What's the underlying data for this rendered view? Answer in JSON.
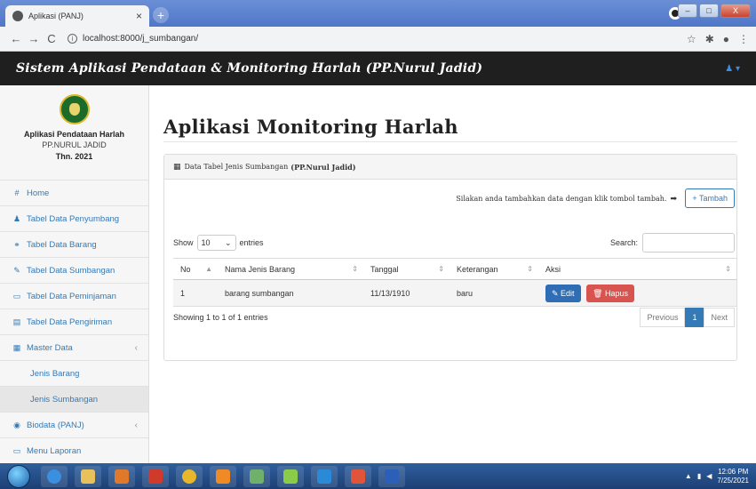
{
  "browser": {
    "tab_title": "Aplikasi (PANJ)",
    "tab_close": "×",
    "new_tab": "+",
    "url": "localhost:8000/j_sumbangan/",
    "win_min": "–",
    "win_max": "□",
    "win_close": "X"
  },
  "app": {
    "title": "Sistem Aplikasi Pendataan & Monitoring Harlah (PP.Nurul Jadid)",
    "user_icon": "user-icon"
  },
  "sidebar": {
    "brand_name": "Aplikasi Pendataan Harlah",
    "brand_org": "PP.NURUL JADID",
    "brand_year": "Thn. 2021",
    "items": [
      {
        "label": "Home",
        "icon": "#"
      },
      {
        "label": "Tabel Data Penyumbang",
        "icon": "♟"
      },
      {
        "label": "Tabel Data Barang",
        "icon": "⚭"
      },
      {
        "label": "Tabel Data Sumbangan",
        "icon": "✎"
      },
      {
        "label": "Tabel Data Peminjaman",
        "icon": "▭"
      },
      {
        "label": "Tabel Data Pengiriman",
        "icon": "▤"
      },
      {
        "label": "Master Data",
        "icon": "▦"
      },
      {
        "label": "Jenis Barang"
      },
      {
        "label": "Jenis Sumbangan"
      },
      {
        "label": "Biodata (PANJ)",
        "icon": "◉"
      },
      {
        "label": "Menu Laporan",
        "icon": "▭"
      }
    ]
  },
  "main": {
    "page_title": "Aplikasi Monitoring Harlah",
    "panel_title": "Data Tabel Jenis Sumbangan",
    "panel_title_bold": "(PP.Nurul Jadid)",
    "add_hint": "Silakan anda tambahkan data dengan klik tombol tambah.",
    "add_button": "+ Tambah",
    "show_label": "Show",
    "entries_value": "10",
    "entries_label": "entries",
    "search_label": "Search:",
    "columns": [
      "No",
      "Nama Jenis Barang",
      "Tanggal",
      "Keterangan",
      "Aksi"
    ],
    "rows": [
      {
        "no": "1",
        "nama": "barang sumbangan",
        "tanggal": "11/13/1910",
        "keterangan": "baru"
      }
    ],
    "edit_label": "Edit",
    "hapus_label": "Hapus",
    "showing": "Showing 1 to 1 of 1 entries",
    "pagination": {
      "previous": "Previous",
      "page": "1",
      "next": "Next"
    }
  },
  "taskbar": {
    "time": "12:06 PM",
    "date": "7/25/2021"
  },
  "colors": {
    "primary": "#337ab7",
    "danger": "#d9534f",
    "header_bg": "#1f1f1f"
  }
}
